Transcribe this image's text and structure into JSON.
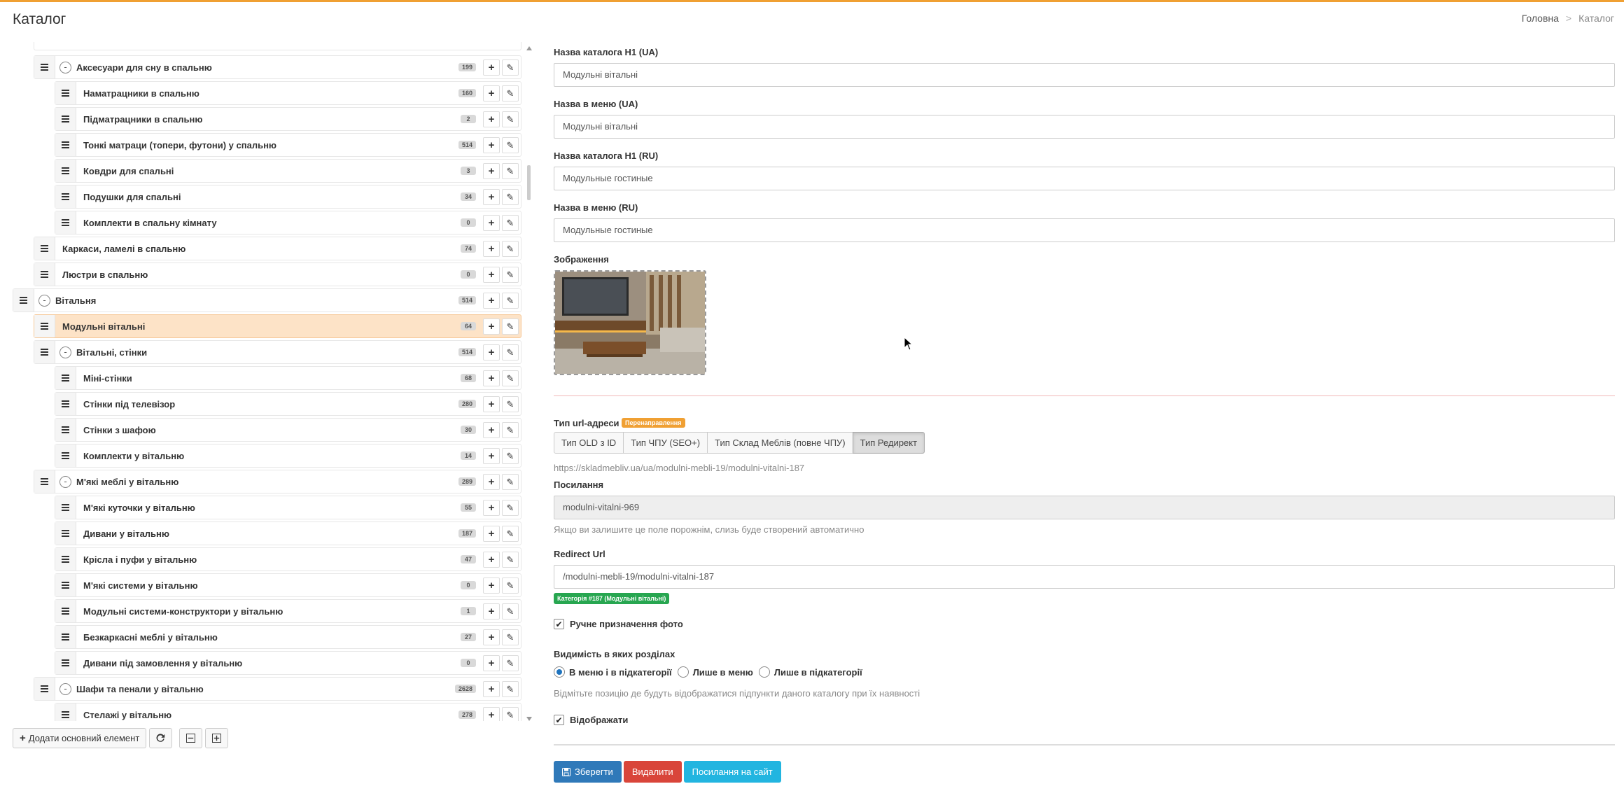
{
  "header": {
    "title": "Каталог"
  },
  "breadcrumb": {
    "home": "Головна",
    "separator": ">",
    "current": "Каталог"
  },
  "tree": {
    "rows": [
      {
        "label": "Аксесуари для сну в спальню",
        "count": "199",
        "level": 1,
        "toggle": "-"
      },
      {
        "label": "Наматрацники в спальню",
        "count": "160",
        "level": 2
      },
      {
        "label": "Підматрацники в спальню",
        "count": "2",
        "level": 2
      },
      {
        "label": "Тонкі матраци (топери, футони) у спальню",
        "count": "514",
        "level": 2
      },
      {
        "label": "Ковдри для спальні",
        "count": "3",
        "level": 2
      },
      {
        "label": "Подушки для спальні",
        "count": "34",
        "level": 2
      },
      {
        "label": "Комплекти в спальну кімнату",
        "count": "0",
        "level": 2
      },
      {
        "label": "Каркаси, ламелі в спальню",
        "count": "74",
        "level": 1
      },
      {
        "label": "Люстри в спальню",
        "count": "0",
        "level": 1
      },
      {
        "label": "Вітальня",
        "count": "514",
        "level": 0,
        "toggle": "-"
      },
      {
        "label": "Модульні вітальні",
        "count": "64",
        "level": 1,
        "active": true
      },
      {
        "label": "Вітальні, стінки",
        "count": "514",
        "level": 1,
        "toggle": "-"
      },
      {
        "label": "Міні-стінки",
        "count": "68",
        "level": 2
      },
      {
        "label": "Стінки під телевізор",
        "count": "280",
        "level": 2
      },
      {
        "label": "Стінки з шафою",
        "count": "30",
        "level": 2
      },
      {
        "label": "Комплекти у вітальню",
        "count": "14",
        "level": 2
      },
      {
        "label": "М'які меблі у вітальню",
        "count": "289",
        "level": 1,
        "toggle": "-"
      },
      {
        "label": "М'які куточки у вітальню",
        "count": "55",
        "level": 2
      },
      {
        "label": "Дивани у вітальню",
        "count": "187",
        "level": 2
      },
      {
        "label": "Крісла і пуфи у вітальню",
        "count": "47",
        "level": 2
      },
      {
        "label": "М'які системи у вітальню",
        "count": "0",
        "level": 2
      },
      {
        "label": "Модульні системи-конструктори у вітальню",
        "count": "1",
        "level": 2
      },
      {
        "label": "Безкаркасні меблі у вітальню",
        "count": "27",
        "level": 2
      },
      {
        "label": "Дивани під замовлення у вітальню",
        "count": "0",
        "level": 2
      },
      {
        "label": "Шафи та пенали у вітальню",
        "count": "2628",
        "level": 1,
        "toggle": "-"
      },
      {
        "label": "Стелажі у вітальню",
        "count": "278",
        "level": 2
      }
    ],
    "add_main_label": "Додати основний елемент"
  },
  "form": {
    "h1_ua_label": "Назва каталога H1 (UA)",
    "h1_ua_value": "Модульні вітальні",
    "menu_ua_label": "Назва в меню (UA)",
    "menu_ua_value": "Модульні вітальні",
    "h1_ru_label": "Назва каталога H1 (RU)",
    "h1_ru_value": "Модульные гостиные",
    "menu_ru_label": "Назва в меню (RU)",
    "menu_ru_value": "Модульные гостиные",
    "image_label": "Зображення",
    "url_type_label": "Тип url-адреси",
    "url_type_badge": "Перенаправлення",
    "url_types": [
      "Тип OLD з ID",
      "Тип ЧПУ (SEO+)",
      "Тип Склад Меблів (повне ЧПУ)",
      "Тип Редирект"
    ],
    "url_type_selected": "Тип Редирект",
    "current_url": "https://skladmebliv.ua/ua/modulni-mebli-19/modulni-vitalni-187",
    "slug_label": "Посилання",
    "slug_value": "modulni-vitalni-969",
    "slug_help": "Якщо ви залишите це поле порожнім, слизь буде створений автоматично",
    "redirect_label": "Redirect Url",
    "redirect_value": "/modulni-mebli-19/modulni-vitalni-187",
    "redirect_badge": "Категорія #187 (Модульні вітальні)",
    "manual_photo_label": "Ручне призначення фото",
    "visibility_label": "Видимість в яких розділах",
    "visibility_options": [
      "В меню і в підкатегорії",
      "Лише в меню",
      "Лише в підкатегорії"
    ],
    "visibility_selected": "В меню і в підкатегорії",
    "visibility_help": "Відмітьте позицію де будуть відображатися підпункти даного каталогу при їх наявності",
    "display_label": "Відображати"
  },
  "actions": {
    "save": "Зберегти",
    "delete": "Видалити",
    "site_link": "Посилання на сайт"
  },
  "colors": {
    "accent": "#f0a033",
    "active_row": "#fde3c7",
    "primary": "#2f79b9",
    "danger": "#d9453a",
    "info": "#22b5e0",
    "success": "#27a650"
  }
}
